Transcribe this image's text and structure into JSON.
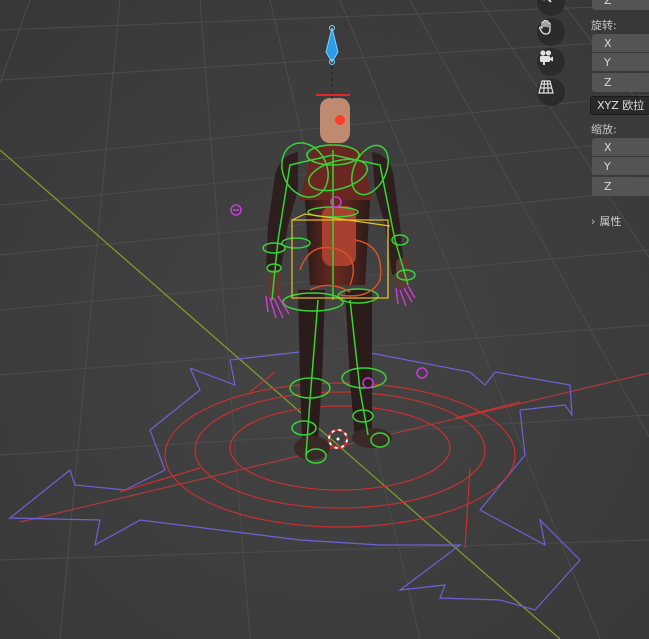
{
  "viewport": {
    "name": "3D Viewport",
    "scene": "rigged robot character with armature controls"
  },
  "nav_gizmo": {
    "buttons": [
      {
        "icon": "zoom-icon"
      },
      {
        "icon": "hand-icon"
      },
      {
        "icon": "camera-icon"
      },
      {
        "icon": "perspective-grid-icon"
      }
    ]
  },
  "properties_panel": {
    "location": {
      "axes": [
        "Z"
      ]
    },
    "rotation": {
      "label": "旋转:",
      "axes": [
        "X",
        "Y",
        "Z"
      ],
      "mode": "XYZ 欧拉"
    },
    "scale": {
      "label": "缩放:",
      "axes": [
        "X",
        "Y",
        "Z"
      ]
    },
    "custom_props": {
      "label": "属性"
    }
  }
}
